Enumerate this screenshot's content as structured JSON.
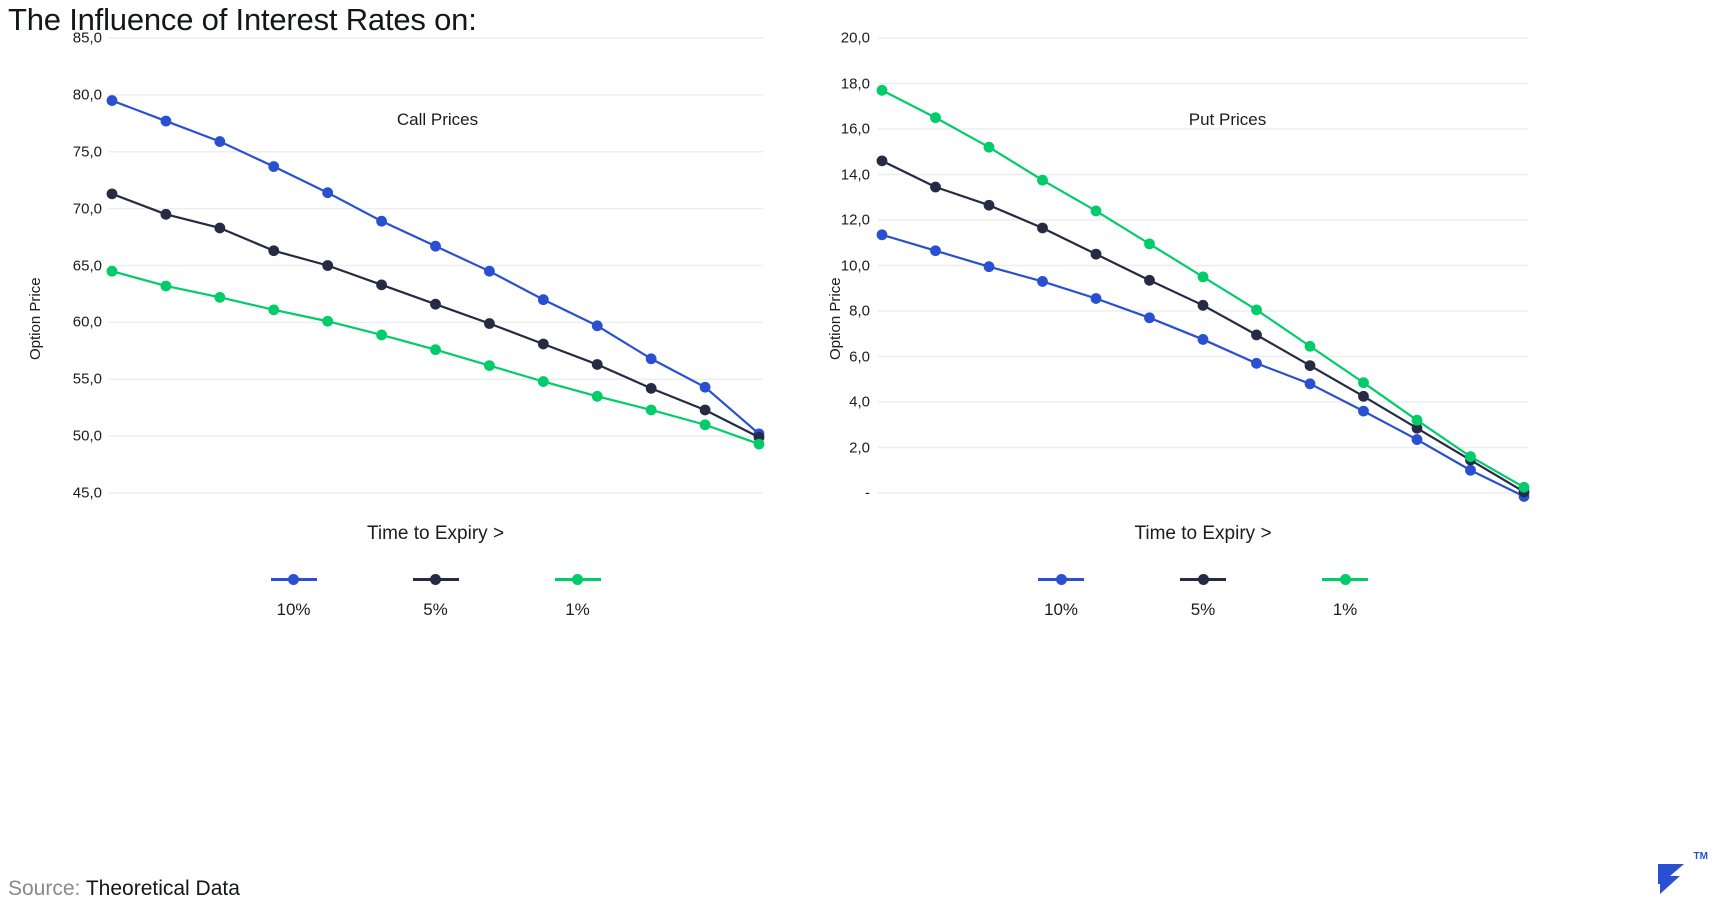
{
  "title": "The Influence of Interest Rates on:",
  "source": {
    "label": "Source:",
    "value": "Theoretical Data"
  },
  "logo": {
    "name": "toptal-logo",
    "tm": "TM",
    "color": "#2850D0"
  },
  "colors": {
    "rate10": "#2850D0",
    "rate5": "#252B42",
    "rate1": "#00CC6A",
    "gridline": "#eceef0",
    "text": "#1c1c1c"
  },
  "legend": [
    {
      "label": "10%",
      "color": "#2850D0"
    },
    {
      "label": "5%",
      "color": "#252B42"
    },
    {
      "label": "1%",
      "color": "#00CC6A"
    }
  ],
  "panels": {
    "call": {
      "title": "Call Prices",
      "xlabel": "Time to Expiry >",
      "ylabel": "Option Price"
    },
    "put": {
      "title": "Put Prices",
      "xlabel": "Time to Expiry >",
      "ylabel": "Option Price"
    }
  },
  "chart_data": [
    {
      "type": "line",
      "title": "Call Prices",
      "xlabel": "Time to Expiry >",
      "ylabel": "Option Price",
      "ylim": [
        45.0,
        85.0
      ],
      "ytick_values": [
        85.0,
        80.0,
        75.0,
        70.0,
        65.0,
        60.0,
        55.0,
        50.0,
        45.0
      ],
      "ytick_labels": [
        "85,0",
        "80,0",
        "75,0",
        "70,0",
        "65,0",
        "60,0",
        "55,0",
        "50,0",
        "45,0"
      ],
      "x": [
        1,
        2,
        3,
        4,
        5,
        6,
        7,
        8,
        9,
        10,
        11,
        12,
        13
      ],
      "grid": true,
      "legend_position": "bottom",
      "series": [
        {
          "name": "10%",
          "color": "#2850D0",
          "values": [
            79.5,
            77.7,
            75.9,
            73.7,
            71.4,
            68.9,
            66.7,
            64.5,
            62.0,
            59.7,
            56.8,
            54.3,
            50.2
          ]
        },
        {
          "name": "5%",
          "color": "#252B42",
          "values": [
            71.3,
            69.5,
            68.3,
            66.3,
            65.0,
            63.3,
            61.6,
            59.9,
            58.1,
            56.3,
            54.2,
            52.3,
            49.9
          ]
        },
        {
          "name": "1%",
          "color": "#00CC6A",
          "values": [
            64.5,
            63.2,
            62.2,
            61.1,
            60.1,
            58.9,
            57.6,
            56.2,
            54.8,
            53.5,
            52.3,
            51.0,
            49.3
          ]
        }
      ]
    },
    {
      "type": "line",
      "title": "Put Prices",
      "xlabel": "Time to Expiry >",
      "ylabel": "Option Price",
      "ylim": [
        0.0,
        20.0
      ],
      "ytick_values": [
        20.0,
        18.0,
        16.0,
        14.0,
        12.0,
        10.0,
        8.0,
        6.0,
        4.0,
        2.0,
        0.0
      ],
      "ytick_labels": [
        "20,0",
        "18,0",
        "16,0",
        "14,0",
        "12,0",
        "10,0",
        "8,0",
        "6,0",
        "4,0",
        "2,0",
        "-"
      ],
      "x": [
        1,
        2,
        3,
        4,
        5,
        6,
        7,
        8,
        9,
        10,
        11,
        12,
        13
      ],
      "grid": true,
      "legend_position": "bottom",
      "series": [
        {
          "name": "10%",
          "color": "#2850D0",
          "values": [
            11.35,
            10.65,
            9.95,
            9.3,
            8.55,
            7.7,
            6.75,
            5.7,
            4.8,
            3.6,
            2.35,
            1.0,
            -0.15
          ]
        },
        {
          "name": "5%",
          "color": "#252B42",
          "values": [
            14.6,
            13.45,
            12.65,
            11.65,
            10.5,
            9.35,
            8.25,
            6.95,
            5.6,
            4.25,
            2.85,
            1.45,
            0.05
          ]
        },
        {
          "name": "1%",
          "color": "#00CC6A",
          "values": [
            17.7,
            16.5,
            15.2,
            13.75,
            12.4,
            10.95,
            9.5,
            8.05,
            6.45,
            4.85,
            3.2,
            1.6,
            0.25
          ]
        }
      ]
    }
  ]
}
